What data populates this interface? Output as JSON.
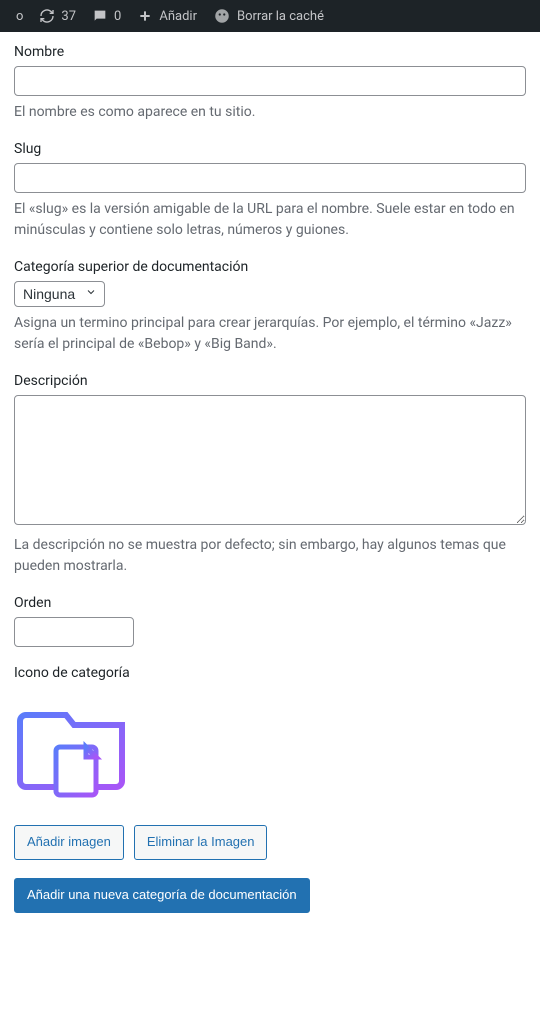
{
  "adminbar": {
    "site_partial": "o",
    "updates_count": "37",
    "comments_count": "0",
    "add_label": "Añadir",
    "clear_cache_label": "Borrar la caché"
  },
  "form": {
    "name": {
      "label": "Nombre",
      "value": "",
      "description": "El nombre es como aparece en tu sitio."
    },
    "slug": {
      "label": "Slug",
      "value": "",
      "description": "El «slug» es la versión amigable de la URL para el nombre. Suele estar en todo en minúsculas y contiene solo letras, números y guiones."
    },
    "parent": {
      "label": "Categoría superior de documentación",
      "selected": "Ninguna",
      "description": "Asigna un termino principal para crear jerarquías. Por ejemplo, el término «Jazz» sería el principal de «Bebop» y «Big Band»."
    },
    "description": {
      "label": "Descripción",
      "value": "",
      "description": "La descripción no se muestra por defecto; sin embargo, hay algunos temas que pueden mostrarla."
    },
    "order": {
      "label": "Orden",
      "value": ""
    },
    "icon": {
      "label": "Icono de categoría",
      "add_image_button": "Añadir imagen",
      "remove_image_button": "Eliminar la Imagen"
    },
    "submit_button": "Añadir una nueva categoría de documentación"
  }
}
